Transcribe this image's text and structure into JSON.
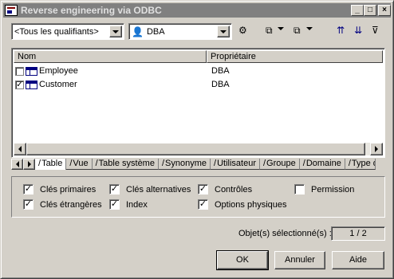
{
  "window": {
    "title": "Reverse engineering via ODBC",
    "controls": {
      "minimize": "_",
      "maximize": "□",
      "close": "×"
    }
  },
  "toolbar": {
    "qualifier_value": "<Tous les qualifiants>",
    "owner_value": "DBA",
    "icons": [
      "owner-select-icon",
      "select-all-icon",
      "deselect-all-icon",
      "move-up-icon",
      "move-down-icon",
      "filter-icon"
    ]
  },
  "list": {
    "columns": [
      "Nom",
      "Propriétaire"
    ],
    "rows": [
      {
        "checked": false,
        "name": "Employee",
        "owner": "DBA"
      },
      {
        "checked": true,
        "name": "Customer",
        "owner": "DBA"
      }
    ]
  },
  "tabs": [
    "Table",
    "Vue",
    "Table système",
    "Synonyme",
    "Utilisateur",
    "Groupe",
    "Domaine",
    "Type d"
  ],
  "active_tab": "Table",
  "options": {
    "cles_primaires": {
      "label": "Clés primaires",
      "checked": true
    },
    "cles_etrangeres": {
      "label": "Clés étrangères",
      "checked": true
    },
    "cles_alternatives": {
      "label": "Clés alternatives",
      "checked": true
    },
    "index": {
      "label": "Index",
      "checked": true
    },
    "controles": {
      "label": "Contrôles",
      "checked": true
    },
    "options_physiques": {
      "label": "Options physiques",
      "checked": true
    },
    "permission": {
      "label": "Permission",
      "checked": false
    }
  },
  "status": {
    "label": "Objet(s) sélectionné(s) :",
    "value": "1 / 2"
  },
  "buttons": {
    "ok": "OK",
    "cancel": "Annuler",
    "help": "Aide"
  }
}
